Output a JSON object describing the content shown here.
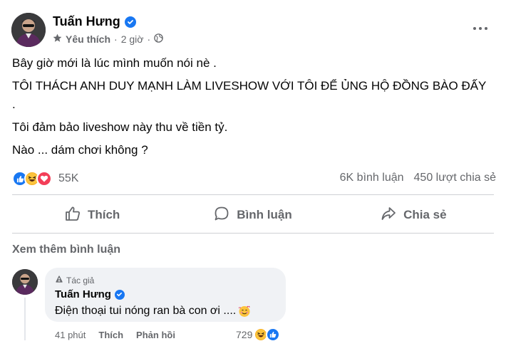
{
  "post": {
    "author": "Tuấn Hưng",
    "favorite_label": "Yêu thích",
    "separator": "·",
    "time": "2 giờ",
    "paragraphs": [
      "Bây giờ mới là lúc mình muốn nói nè .",
      "TÔI THÁCH ANH DUY MẠNH LÀM LIVESHOW VỚI TÔI ĐỂ ỦNG HỘ ĐỒNG BÀO ĐẤY",
      ".",
      "Tôi đảm bảo liveshow này thu về tiền tỷ.",
      "Nào ... dám chơi không ?"
    ]
  },
  "stats": {
    "reaction_count": "55K",
    "comments": "6K bình luận",
    "shares": "450 lượt chia sẻ"
  },
  "actions": {
    "like": "Thích",
    "comment": "Bình luận",
    "share": "Chia sẻ"
  },
  "more_comments": "Xem thêm bình luận",
  "comment": {
    "badge": "Tác giả",
    "author": "Tuấn Hưng",
    "text": "Điện thoại tui nóng ran bà con ơi ....",
    "time": "41 phút",
    "like": "Thích",
    "reply": "Phản hồi",
    "reaction_count": "729"
  },
  "colors": {
    "brand_blue": "#1877f2",
    "secondary_text": "#65676b",
    "bubble_bg": "#f0f2f5"
  },
  "icons": [
    "verified-icon",
    "star-icon",
    "globe-icon",
    "more-icon",
    "like-reaction-icon",
    "haha-reaction-icon",
    "love-reaction-icon",
    "thumbs-up-icon",
    "comment-icon",
    "share-icon",
    "author-badge-icon",
    "smiling-hearts-emoji"
  ]
}
